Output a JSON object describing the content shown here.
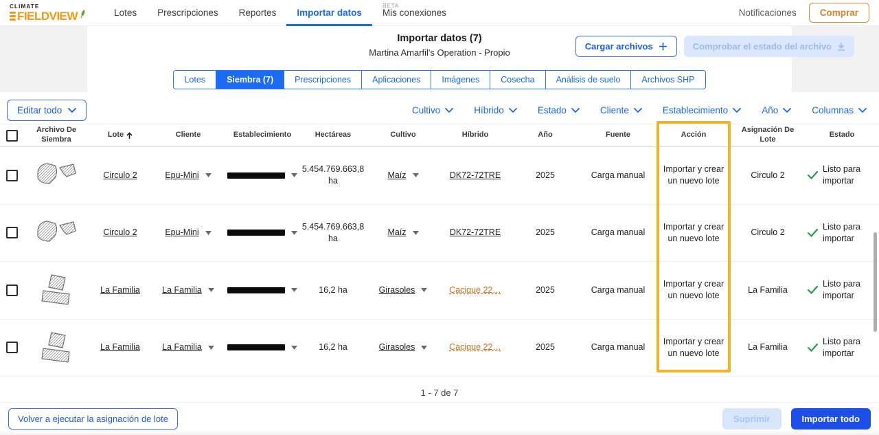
{
  "colors": {
    "primary_blue": "#1a6af3",
    "solid_button_blue": "#1d4fe8",
    "brand_orange": "#f2990f",
    "comprar_orange": "#d9822b",
    "highlight_yellow": "#f0b429",
    "success_green": "#21a04a",
    "hybrid_orange_link": "#c4711c"
  },
  "navbar": {
    "logo_top": "CLIMATE",
    "logo_main": "FIELDVIEW",
    "items": [
      {
        "label": "Lotes"
      },
      {
        "label": "Prescripciones"
      },
      {
        "label": "Reportes"
      },
      {
        "label": "Importar datos"
      },
      {
        "label": "Mis conexiones",
        "badge": "BETA"
      }
    ],
    "notifications": "Notificaciones",
    "buy": "Comprar"
  },
  "header": {
    "title": "Importar datos (7)",
    "subtitle": "Martina Amarfil's Operation - Propio",
    "upload": "Cargar archivos",
    "check_status": "Comprobar el estado del archivo"
  },
  "tabs": [
    {
      "label": "Lotes"
    },
    {
      "label": "Siembra (7)"
    },
    {
      "label": "Prescripciones"
    },
    {
      "label": "Aplicaciones"
    },
    {
      "label": "Imágenes"
    },
    {
      "label": "Cosecha"
    },
    {
      "label": "Análisis de suelo"
    },
    {
      "label": "Archivos SHP"
    }
  ],
  "active_tab": "Siembra (7)",
  "filters": {
    "edit_all": "Editar todo",
    "cultivo": "Cultivo",
    "hibrido": "Híbrido",
    "estado": "Estado",
    "cliente": "Cliente",
    "establecimiento": "Establecimiento",
    "anio": "Año",
    "columnas": "Columnas"
  },
  "table": {
    "headers": {
      "archivo": "Archivo De Siembra",
      "lote": "Lote",
      "cliente": "Cliente",
      "establecimiento": "Establecimiento",
      "hectareas": "Hectáreas",
      "cultivo": "Cultivo",
      "hibrido": "Híbrido",
      "anio": "Año",
      "fuente": "Fuente",
      "accion": "Acción",
      "asignacion": "Asignación De Lote",
      "estado": "Estado"
    },
    "sorted_column": "Lote",
    "highlighted_column": "Acción",
    "rows": [
      {
        "lote": "Circulo 2",
        "cliente": "Epu-Mini",
        "hectareas": "5.454.769.663,8 ha",
        "cultivo": "Maíz",
        "hibrido": "DK72-72TRE",
        "anio": "2025",
        "fuente": "Carga manual",
        "accion": "Importar y crear un nuevo lote",
        "asignacion": "Circulo 2",
        "estado": "Listo para importar"
      },
      {
        "lote": "Circulo 2",
        "cliente": "Epu-Mini",
        "hectareas": "5.454.769.663,8 ha",
        "cultivo": "Maíz",
        "hibrido": "DK72-72TRE",
        "anio": "2025",
        "fuente": "Carga manual",
        "accion": "Importar y crear un nuevo lote",
        "asignacion": "Circulo 2",
        "estado": "Listo para importar"
      },
      {
        "lote": "La Familia",
        "cliente": "La Familia",
        "hectareas": "16,2 ha",
        "cultivo": "Girasoles",
        "hibrido": "Cacique 22…",
        "anio": "2025",
        "fuente": "Carga manual",
        "accion": "Importar y crear un nuevo lote",
        "asignacion": "La Familia",
        "estado": "Listo para importar"
      },
      {
        "lote": "La Familia",
        "cliente": "La Familia",
        "hectareas": "16,2 ha",
        "cultivo": "Girasoles",
        "hibrido": "Cacique 22…",
        "anio": "2025",
        "fuente": "Carga manual",
        "accion": "Importar y crear un nuevo lote",
        "asignacion": "La Familia",
        "estado": "Listo para importar"
      }
    ]
  },
  "pagination": "1 - 7 de 7",
  "footer": {
    "rerun": "Volver a ejecutar la asignación de lote",
    "delete": "Suprimir",
    "import_all": "Importar todo"
  }
}
